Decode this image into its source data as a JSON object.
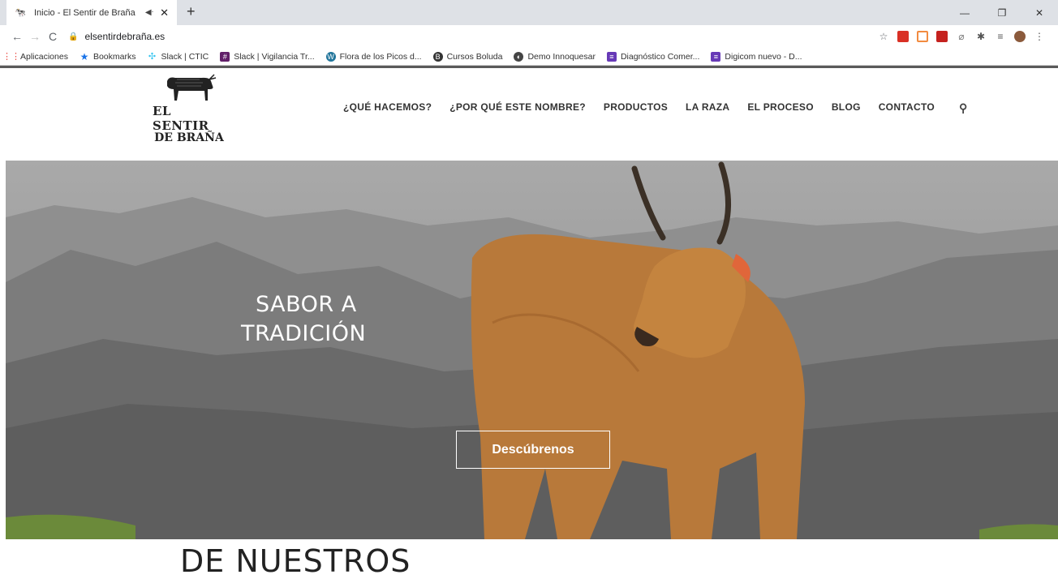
{
  "browser": {
    "tab_title": "Inicio - El Sentir de Braña",
    "url": "elsentirdebraña.es",
    "bookmarks": [
      {
        "label": "Aplicaciones",
        "icon": "apps-grid-icon",
        "color": "#e8453c"
      },
      {
        "label": "Bookmarks",
        "icon": "star-icon",
        "color": "#1a73e8"
      },
      {
        "label": "Slack | CTIC",
        "icon": "slack-icon",
        "color": "#36c5f0"
      },
      {
        "label": "Slack | Vigilancia Tr...",
        "icon": "slack-icon",
        "color": "#611f69"
      },
      {
        "label": "Flora de los Picos d...",
        "icon": "wordpress-icon",
        "color": "#21759b"
      },
      {
        "label": "Cursos Boluda",
        "icon": "b-icon",
        "color": "#333333"
      },
      {
        "label": "Demo Innoquesar",
        "icon": "globe-icon",
        "color": "#444444"
      },
      {
        "label": "Diagnóstico Comer...",
        "icon": "forms-icon",
        "color": "#673ab7"
      },
      {
        "label": "Digicom nuevo - D...",
        "icon": "forms-icon",
        "color": "#673ab7"
      }
    ]
  },
  "site": {
    "logo_line1": "EL SENTIR",
    "logo_line2": "DE BRAÑA",
    "nav": [
      "¿QUÉ HACEMOS?",
      "¿POR QUÉ ESTE NOMBRE?",
      "PRODUCTOS",
      "LA RAZA",
      "EL PROCESO",
      "BLOG",
      "CONTACTO"
    ],
    "hero": {
      "title_line1": "SABOR A",
      "title_line2": "TRADICIÓN",
      "cta": "Descúbrenos"
    },
    "next_section_heading": "DE NUESTROS"
  },
  "colors": {
    "cow": "#b8793a",
    "hero_bg": "#8a8a8a"
  }
}
